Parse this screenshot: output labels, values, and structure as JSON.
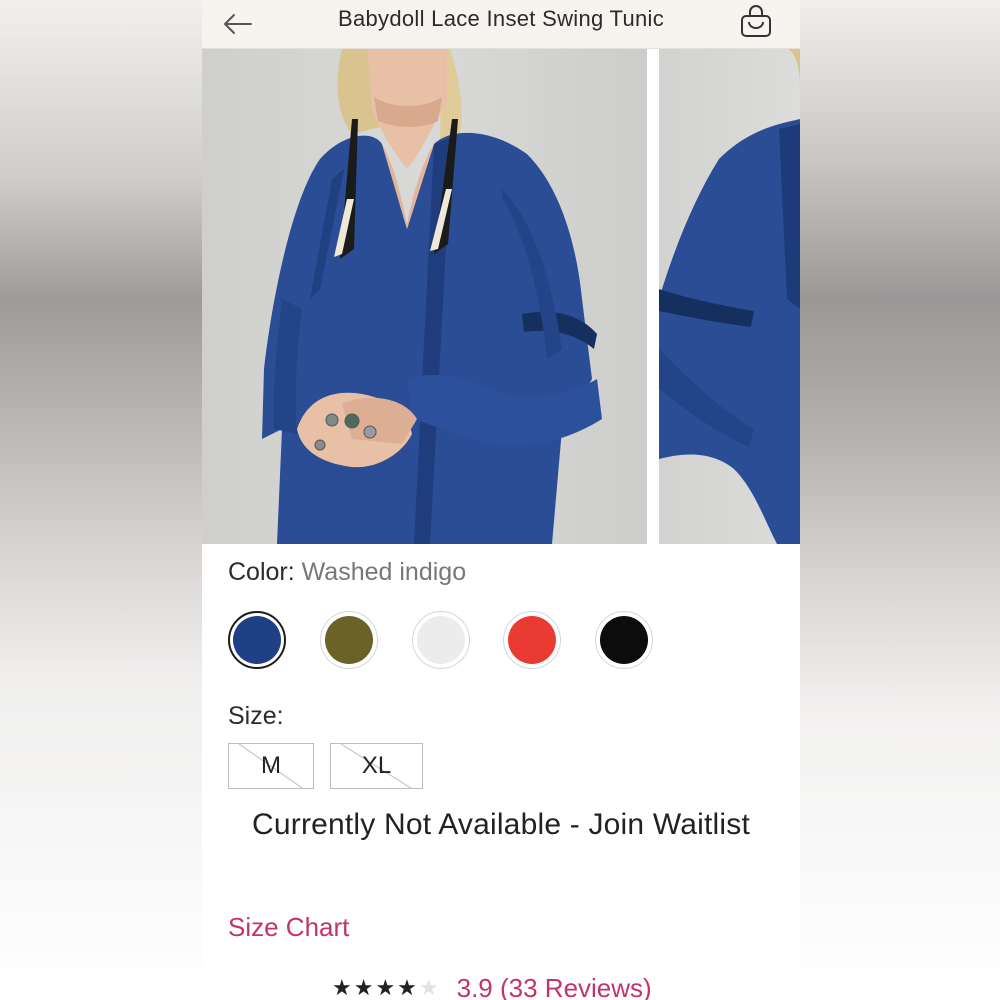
{
  "header": {
    "title": "Babydoll Lace Inset Swing Tunic"
  },
  "product": {
    "color_label": "Color:",
    "color_value": "Washed indigo",
    "swatches": [
      {
        "name": "Washed indigo",
        "color": "#1f3f86",
        "selected": true
      },
      {
        "name": "Olive",
        "color": "#6b6228",
        "selected": false
      },
      {
        "name": "White",
        "color": "#ececec",
        "selected": false
      },
      {
        "name": "Red",
        "color": "#ea3a34",
        "selected": false
      },
      {
        "name": "Black",
        "color": "#0c0c0c",
        "selected": false
      }
    ],
    "size_label": "Size:",
    "sizes": [
      {
        "label": "M",
        "available": false
      },
      {
        "label": "XL",
        "available": false
      }
    ],
    "availability": "Currently Not Available - Join Waitlist",
    "size_chart": "Size Chart",
    "rating_stars": "★★★★",
    "rating_empty_star": "★",
    "rating_value": 3.9,
    "reviews_text": "3.9 (33 Reviews)"
  },
  "colors": {
    "accent": "#c2346d",
    "header_bg": "#f7f3ef",
    "dress_blue": "#2a4d96"
  },
  "icons": {
    "back": "arrow-left-icon",
    "bag": "shopping-bag-icon"
  }
}
